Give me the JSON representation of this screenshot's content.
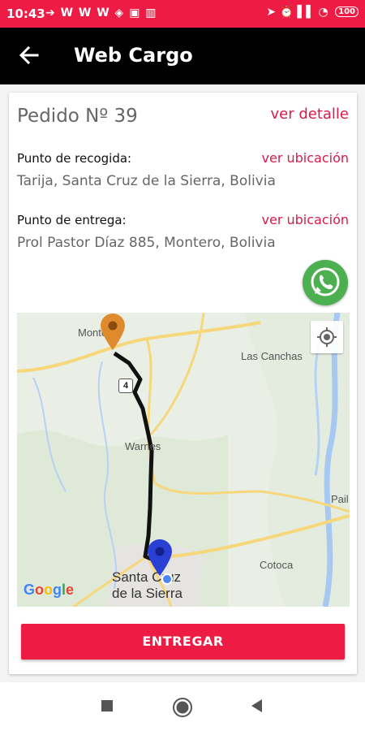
{
  "status_bar": {
    "time": "10:43",
    "left_icons_text": "➔ W W W ◈ ▣ ▥",
    "right_icons_text": "➤ ⏰ ▌▌ ◔",
    "battery": "100"
  },
  "app_bar": {
    "title": "Web Cargo",
    "back_icon": "arrow-left-icon"
  },
  "order": {
    "title": "Pedido Nº 39",
    "detail_link": "ver detalle"
  },
  "pickup": {
    "label": "Punto de recogida:",
    "link": "ver ubicación",
    "address": "Tarija, Santa Cruz de la Sierra, Bolivia"
  },
  "delivery": {
    "label": "Punto de entrega:",
    "link": "ver ubicación",
    "address": "Prol Pastor Díaz 885, Montero, Bolivia"
  },
  "whatsapp": {
    "icon": "whatsapp-icon"
  },
  "map": {
    "places": {
      "montero": "Montero",
      "las_canchas": "Las Canchas",
      "warnes": "Warnes",
      "pail": "Pail",
      "cotoca": "Cotoca",
      "santa_cruz_line1": "Santa Cruz",
      "santa_cruz_line2": "de la Sierra"
    },
    "route_number": "4",
    "logo": {
      "G": "G",
      "o1": "o",
      "o2": "o",
      "g": "g",
      "l": "l",
      "e": "e"
    },
    "colors": {
      "origin_pin": "#e08a2e",
      "destination_pin": "#2a3fd4",
      "route": "#111111"
    }
  },
  "action_button": {
    "label": "ENTREGAR",
    "color": "#ee1c44"
  },
  "colors": {
    "accent": "#d81b4a",
    "status_bar": "#ee1c44",
    "app_bar": "#000000"
  },
  "navigation": {
    "icons": [
      "stop-square-icon",
      "home-circle-icon",
      "back-triangle-icon"
    ]
  }
}
